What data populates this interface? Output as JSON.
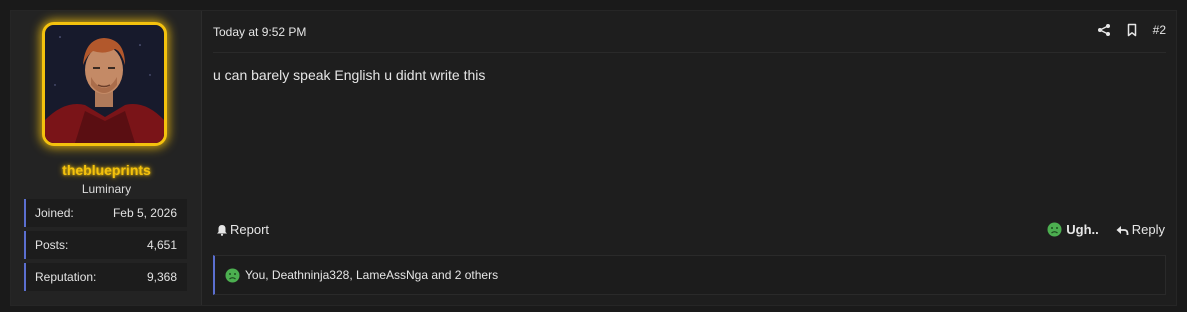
{
  "user": {
    "username": "theblueprints",
    "title": "Luminary",
    "stats": [
      {
        "label": "Joined:",
        "value": "Feb 5, 2026"
      },
      {
        "label": "Posts:",
        "value": "4,651"
      },
      {
        "label": "Reputation:",
        "value": "9,368"
      }
    ],
    "accent_color": "#f4c20d"
  },
  "post": {
    "date": "Today at 9:52 PM",
    "number": "#2",
    "content": "u can barely speak English u didnt write this"
  },
  "actions": {
    "report_label": "Report",
    "reaction_label": "Ugh..",
    "reply_label": "Reply",
    "share_icon": "share-icon",
    "bookmark_icon": "bookmark-icon"
  },
  "reactions": {
    "summary": "You, Deathninja328, LameAssNga and 2 others",
    "emoji": "sick-face-icon"
  }
}
